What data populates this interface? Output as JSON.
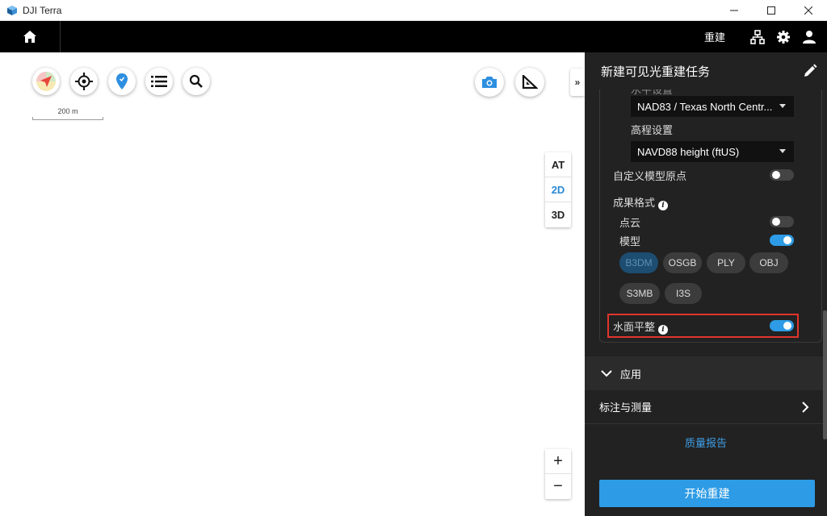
{
  "window": {
    "title": "DJI Terra"
  },
  "nav": {
    "rebuild_label": "重建"
  },
  "map": {
    "scale_label": "200 m",
    "collapse_label": "»",
    "view_modes": [
      "AT",
      "2D",
      "3D"
    ],
    "active_view": "2D",
    "zoom_in": "+",
    "zoom_out": "−"
  },
  "panel": {
    "title": "新建可见光重建任务",
    "partial_label": "水平设置",
    "horizontal_value": "NAD83 / Texas North Centr...",
    "elevation_label": "高程设置",
    "elevation_value": "NAVD88 height (ftUS)",
    "custom_origin_label": "自定义模型原点",
    "output_format_label": "成果格式",
    "point_cloud_label": "点云",
    "model_label": "模型",
    "formats": [
      "B3DM",
      "OSGB",
      "PLY",
      "OBJ",
      "S3MB",
      "I3S"
    ],
    "selected_format": "B3DM",
    "water_flatten_label": "水面平整",
    "info_glyph": "i",
    "apply_label": "应用",
    "measure_label": "标注与测量",
    "quality_report_label": "质量报告",
    "start_button_label": "开始重建"
  },
  "toggles": {
    "custom_origin": false,
    "point_cloud": false,
    "model": true,
    "water_flatten": true
  },
  "colors": {
    "accent": "#2d9be5",
    "panel_bg": "#222222",
    "highlight": "#e2342c"
  }
}
